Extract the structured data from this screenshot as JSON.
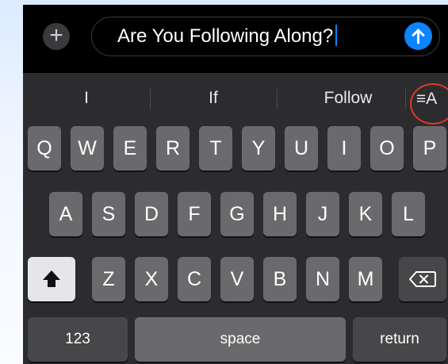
{
  "compose": {
    "text_value": "Are You Following Along?",
    "plus_icon": "plus-icon",
    "send_icon": "arrow-up-icon",
    "accent": "#0a84ff"
  },
  "predictive": {
    "suggestions": [
      "I",
      "If",
      "Follow"
    ],
    "writing_tools_label": "≡A",
    "highlight_color": "#d93a2b"
  },
  "keyboard": {
    "row1": [
      "Q",
      "W",
      "E",
      "R",
      "T",
      "Y",
      "U",
      "I",
      "O",
      "P"
    ],
    "row2": [
      "A",
      "S",
      "D",
      "F",
      "G",
      "H",
      "J",
      "K",
      "L"
    ],
    "row3": [
      "Z",
      "X",
      "C",
      "V",
      "B",
      "N",
      "M"
    ],
    "shift_icon": "shift-icon",
    "delete_icon": "delete-backward-icon",
    "numbers_label": "123",
    "space_label": "space",
    "return_label": "return"
  }
}
